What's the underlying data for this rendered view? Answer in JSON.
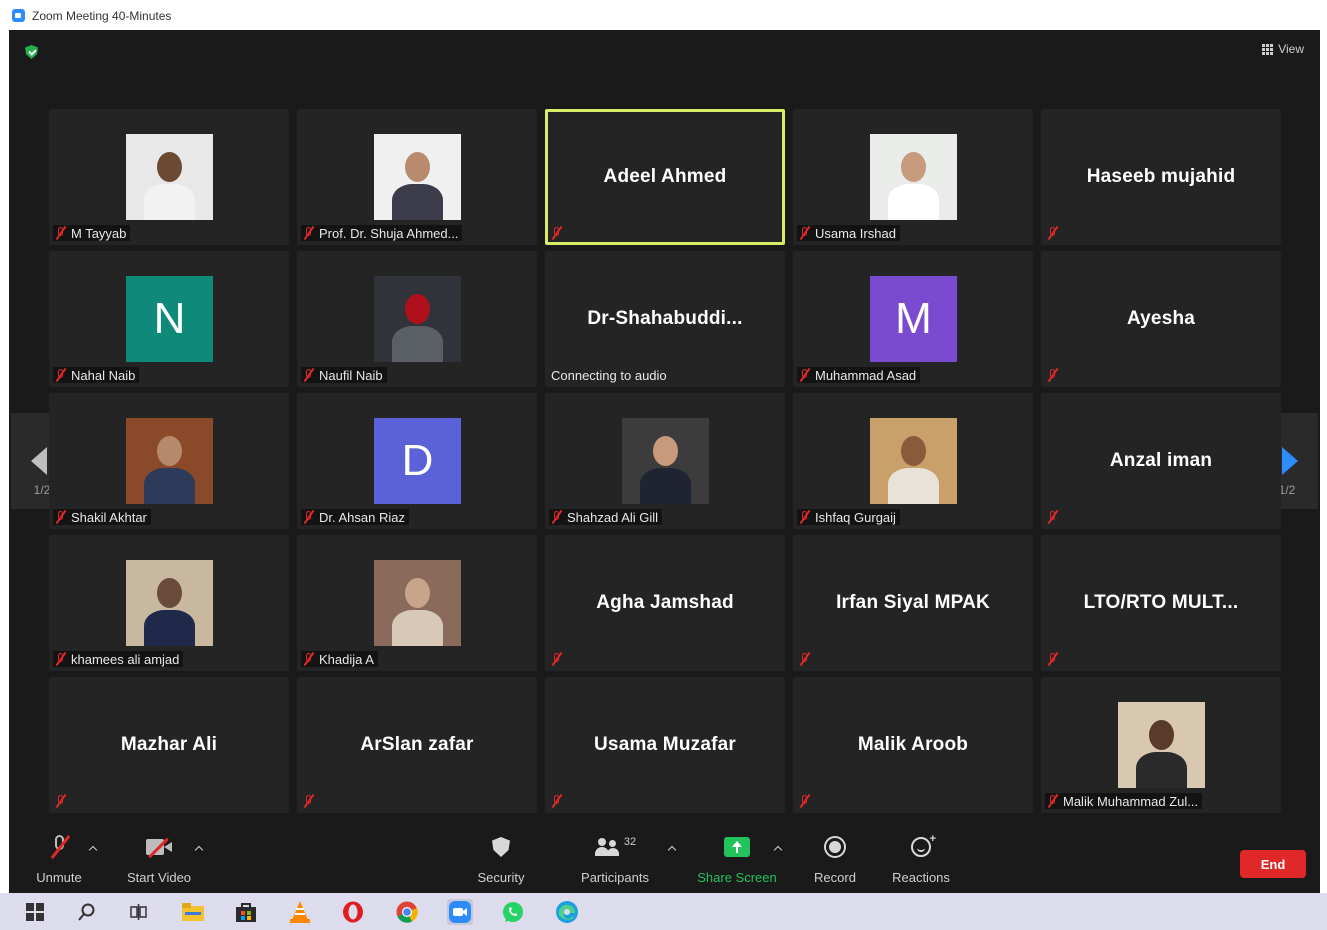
{
  "window": {
    "title": "Zoom Meeting 40-Minutes"
  },
  "header": {
    "view_label": "View"
  },
  "pager": {
    "left": "1/2",
    "right": "1/2"
  },
  "tiles": [
    {
      "name": "M Tayyab",
      "display": "photo"
    },
    {
      "name": "Prof. Dr. Shuja Ahmed...",
      "display": "photo"
    },
    {
      "name": "Adeel Ahmed",
      "display": "name",
      "active": true
    },
    {
      "name": "Usama Irshad",
      "display": "photo"
    },
    {
      "name": "Haseeb mujahid",
      "display": "name"
    },
    {
      "name": "Nahal Naib",
      "display": "initial",
      "initial": "N",
      "color": "#0f8a7a"
    },
    {
      "name": "Naufil Naib",
      "display": "photo"
    },
    {
      "name": "Dr-Shahabuddi...",
      "display": "name",
      "status": "Connecting to audio"
    },
    {
      "name": "Muhammad Asad",
      "display": "initial",
      "initial": "M",
      "color": "#7a4bd1"
    },
    {
      "name": "Ayesha",
      "display": "name"
    },
    {
      "name": "Shakil Akhtar",
      "display": "photo"
    },
    {
      "name": "Dr. Ahsan Riaz",
      "display": "initial",
      "initial": "D",
      "color": "#5b62d8"
    },
    {
      "name": "Shahzad Ali Gill",
      "display": "photo"
    },
    {
      "name": "Ishfaq Gurgaij",
      "display": "photo"
    },
    {
      "name": "Anzal iman",
      "display": "name"
    },
    {
      "name": "khamees ali amjad",
      "display": "photo"
    },
    {
      "name": "Khadija A",
      "display": "photo"
    },
    {
      "name": "Agha Jamshad",
      "display": "name"
    },
    {
      "name": "Irfan Siyal MPAK",
      "display": "name"
    },
    {
      "name": "LTO/RTO  MULT...",
      "display": "name"
    },
    {
      "name": "Mazhar Ali",
      "display": "name"
    },
    {
      "name": "ArSlan zafar",
      "display": "name"
    },
    {
      "name": "Usama Muzafar",
      "display": "name"
    },
    {
      "name": "Malik Aroob",
      "display": "name"
    },
    {
      "name": "Malik Muhammad Zul...",
      "display": "photo"
    }
  ],
  "toolbar": {
    "unmute": "Unmute",
    "start_video": "Start Video",
    "security": "Security",
    "participants": "Participants",
    "participants_count": "32",
    "share_screen": "Share Screen",
    "record": "Record",
    "reactions": "Reactions",
    "end": "End"
  },
  "colors": {
    "share_green": "#23c25d",
    "end_red": "#e02828",
    "active_border": "#d9ee66",
    "accent_blue": "#2d8cff"
  },
  "taskbar_icons": [
    "windows-start-icon",
    "search-icon",
    "task-view-icon",
    "file-explorer-icon",
    "store-icon",
    "vlc-icon",
    "opera-icon",
    "chrome-icon",
    "zoom-icon",
    "whatsapp-icon",
    "edge-icon"
  ]
}
